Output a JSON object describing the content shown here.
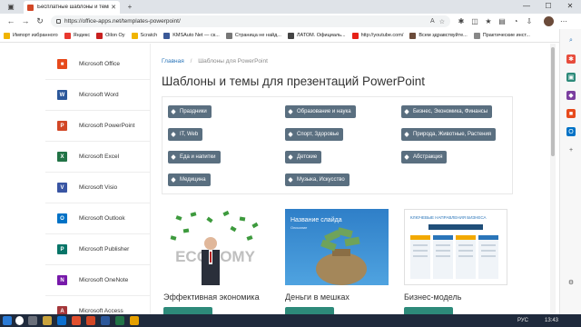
{
  "browser": {
    "tab_title": "Бесплатные шаблоны и темы д",
    "tab_close": "✕",
    "new_tab": "+",
    "url": "https://office-apps.net/templates-powerpoint/",
    "minimize": "—",
    "maximize": "☐",
    "close": "✕"
  },
  "bookmarks": [
    {
      "label": "Импорт избранного",
      "color": "#f0b400"
    },
    {
      "label": "Яндекс",
      "color": "#e8382f"
    },
    {
      "label": "Oilon Oy",
      "color": "#c8201f"
    },
    {
      "label": "Scratch",
      "color": "#f0b400"
    },
    {
      "label": "KMSAuto Net — ск...",
      "color": "#3b5998"
    },
    {
      "label": "Страница не найд...",
      "color": "#777777"
    },
    {
      "label": "ЛАТОМ. Официаль...",
      "color": "#444444"
    },
    {
      "label": "http://youtube.com/",
      "color": "#e62117"
    },
    {
      "label": "Всем здравствуйте...",
      "color": "#6b4b3a"
    },
    {
      "label": "Практические инст...",
      "color": "#888888"
    }
  ],
  "sidebar": {
    "items": [
      {
        "label": "Microsoft Office",
        "color": "#e74a1c",
        "glyph": "■"
      },
      {
        "label": "Microsoft Word",
        "color": "#2b579a",
        "glyph": "W"
      },
      {
        "label": "Microsoft PowerPoint",
        "color": "#d24726",
        "glyph": "P"
      },
      {
        "label": "Microsoft Excel",
        "color": "#217346",
        "glyph": "X"
      },
      {
        "label": "Microsoft Visio",
        "color": "#3955a3",
        "glyph": "V"
      },
      {
        "label": "Microsoft Outlook",
        "color": "#0072c6",
        "glyph": "O"
      },
      {
        "label": "Microsoft Publisher",
        "color": "#077568",
        "glyph": "P"
      },
      {
        "label": "Microsoft OneNote",
        "color": "#7719aa",
        "glyph": "N"
      },
      {
        "label": "Microsoft Access",
        "color": "#a4373a",
        "glyph": "A"
      }
    ]
  },
  "breadcrumb": {
    "home": "Главная",
    "separator": "/",
    "current": "Шаблоны для PowerPoint"
  },
  "page_title": "Шаблоны и темы для презентаций PowerPoint",
  "tags": [
    "Праздники",
    "Образование и наука",
    "Бизнес, Экономика, Финансы",
    "IT, Web",
    "Спорт, Здоровье",
    "Природа, Животные, Растения",
    "Еда и напитки",
    "Детские",
    "Абстракция",
    "Медицина",
    "Музыка, Искусство"
  ],
  "templates": [
    {
      "name": "Эффективная экономика",
      "thumb_text": "ECONOMY"
    },
    {
      "name": "Деньги в мешках",
      "thumb_text": "Название слайда",
      "thumb_subtext": "Описание"
    },
    {
      "name": "Бизнес-модель",
      "thumb_text": "КЛЮЧЕВЫЕ НАПРАВЛЕНИЯ БИЗНЕСА"
    }
  ],
  "colors": {
    "tag_bg": "#5a6f80",
    "link": "#2a75b9",
    "button": "#2d8a7a"
  },
  "taskbar": {
    "lang": "РУС",
    "time": "13:43"
  }
}
